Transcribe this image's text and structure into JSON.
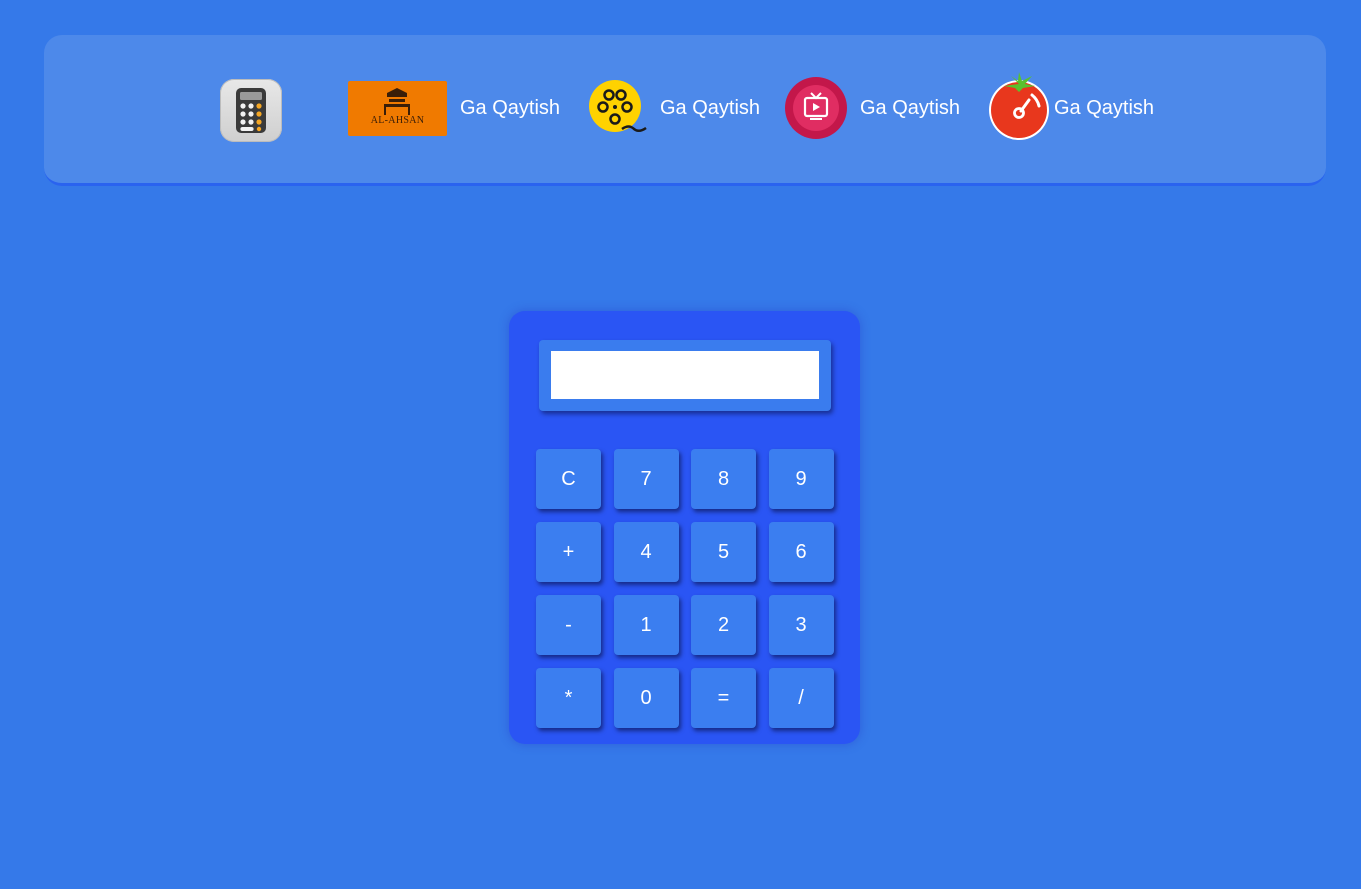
{
  "nav": {
    "items": [
      {
        "label": "Ga Qaytish",
        "logo_text": "AL-AHSAN",
        "icon": "al-ahsan-logo"
      },
      {
        "label": "Ga Qaytish",
        "icon": "film-reel-icon"
      },
      {
        "label": "Ga Qaytish",
        "icon": "tv-play-icon"
      },
      {
        "label": "Ga Qaytish",
        "icon": "tomato-timer-icon"
      }
    ]
  },
  "calculator": {
    "display_value": "",
    "keys": [
      "C",
      "7",
      "8",
      "9",
      "+",
      "4",
      "5",
      "6",
      "-",
      "1",
      "2",
      "3",
      "*",
      "0",
      "=",
      "/"
    ]
  },
  "colors": {
    "background": "#3579e9",
    "topbar": "#4d89ea",
    "calculator_body": "#2a55f4",
    "key": "#3b7ef0",
    "display": "#ffffff"
  }
}
